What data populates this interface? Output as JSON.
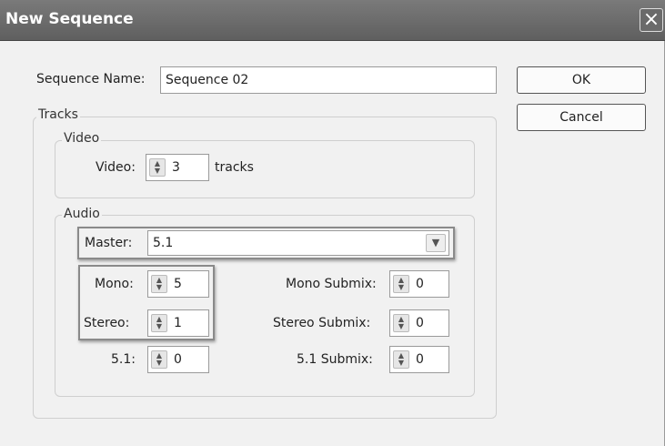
{
  "window": {
    "title": "New Sequence",
    "close_glyph": "×"
  },
  "sequence_name": {
    "label": "Sequence Name:",
    "value": "Sequence 02"
  },
  "buttons": {
    "ok": "OK",
    "cancel": "Cancel"
  },
  "tracks": {
    "legend": "Tracks",
    "video": {
      "legend": "Video",
      "label": "Video:",
      "value": "3",
      "suffix": "tracks"
    },
    "audio": {
      "legend": "Audio",
      "master": {
        "label": "Master:",
        "value": "5.1"
      },
      "mono": {
        "label": "Mono:",
        "value": "5"
      },
      "stereo": {
        "label": "Stereo:",
        "value": "1"
      },
      "five_one": {
        "label": "5.1:",
        "value": "0"
      },
      "mono_submix": {
        "label": "Mono Submix:",
        "value": "0"
      },
      "stereo_submix": {
        "label": "Stereo Submix:",
        "value": "0"
      },
      "five_one_submix": {
        "label": "5.1 Submix:",
        "value": "0"
      }
    }
  },
  "icons": {
    "spinner": "spinner-arrows-icon",
    "dropdown": "chevron-down-icon",
    "close": "close-icon"
  }
}
